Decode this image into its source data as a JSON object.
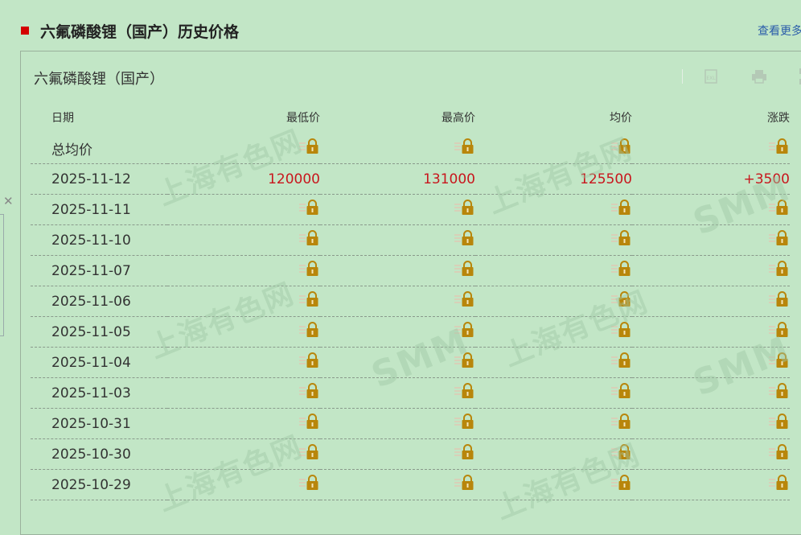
{
  "section": {
    "title": "六氟磷酸锂（国产）历史价格",
    "more_link": "查看更多"
  },
  "panel": {
    "title": "六氟磷酸锂（国产）"
  },
  "toolbar": {
    "icons": [
      "excel-export-icon",
      "print-icon",
      "fullscreen-icon"
    ]
  },
  "table": {
    "headers": [
      "日期",
      "最低价",
      "最高价",
      "均价",
      "涨跌"
    ],
    "summary_label": "总均价",
    "rows": [
      {
        "date": "2025-11-12",
        "low": "120000",
        "high": "131000",
        "avg": "125500",
        "change": "+3500",
        "locked": false
      },
      {
        "date": "2025-11-11",
        "locked": true
      },
      {
        "date": "2025-11-10",
        "locked": true
      },
      {
        "date": "2025-11-07",
        "locked": true
      },
      {
        "date": "2025-11-06",
        "locked": true
      },
      {
        "date": "2025-11-05",
        "locked": true
      },
      {
        "date": "2025-11-04",
        "locked": true
      },
      {
        "date": "2025-11-03",
        "locked": true
      },
      {
        "date": "2025-10-31",
        "locked": true
      },
      {
        "date": "2025-10-30",
        "locked": true
      },
      {
        "date": "2025-10-29",
        "locked": true
      }
    ]
  },
  "colors": {
    "background": "#c2e6c6",
    "accent_red": "#d40000",
    "price_red": "#c8161d",
    "link_blue": "#2a5caa",
    "lock_gold": "#b8860b"
  }
}
